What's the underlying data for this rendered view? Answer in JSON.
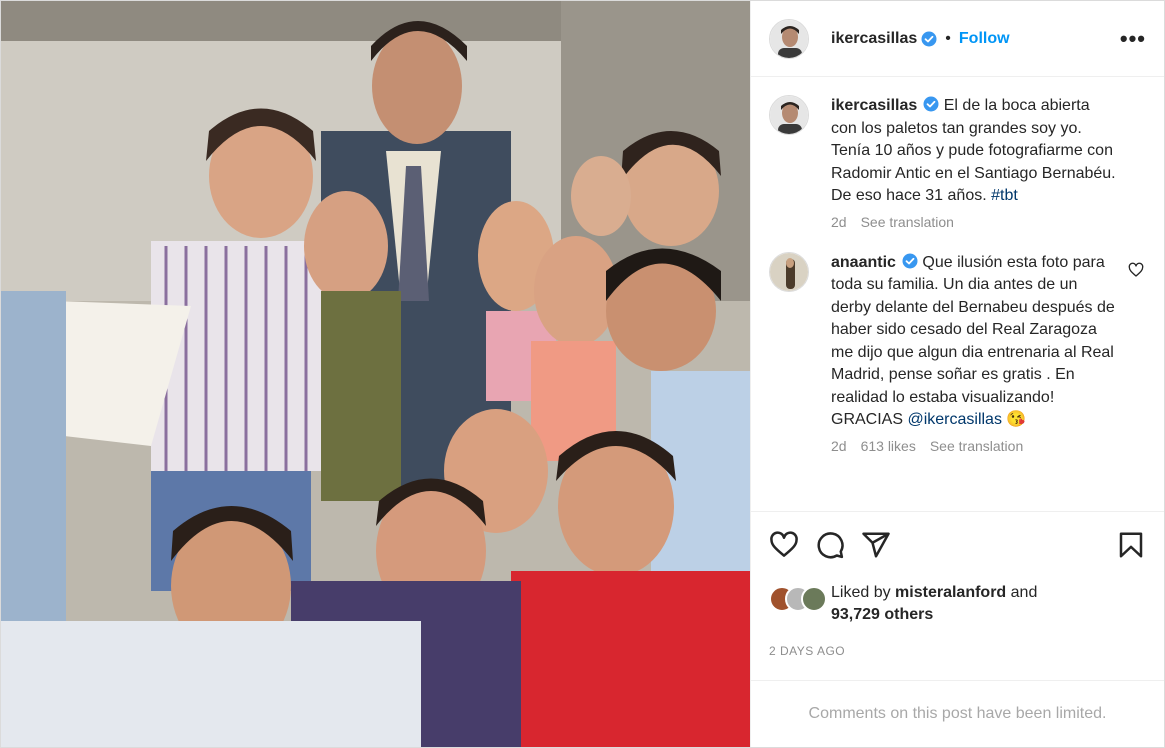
{
  "post": {
    "image_alt": "Group of boys posing with a man in a suit",
    "author": {
      "username": "ikercasillas",
      "verified": true
    },
    "follow_label": "Follow",
    "separator": "•",
    "more_label": "•••"
  },
  "comments": [
    {
      "username": "ikercasillas",
      "text": "El de la boca abierta con los paletos tan grandes soy yo. Tenía 10 años y pude fotografiarme con Radomir Antic en el Santiago Bernabéu. De eso hace 31 años.",
      "hashtag": "#tbt",
      "time": "2d",
      "translate_label": "See translation"
    },
    {
      "username": "anaantic",
      "text": "Que ilusión esta foto para toda su familia. Un dia antes de un derby delante del Bernabeu después de haber sido cesado del Real Zaragoza me dijo que algun dia entrenaria al Real Madrid, pense soñar es gratis . En realidad lo estaba visualizando! GRACIAS",
      "mention": "@ikercasillas",
      "emoji": "😘",
      "time": "2d",
      "likes": "613 likes",
      "translate_label": "See translation"
    }
  ],
  "actions": {
    "like_icon": "heart-icon",
    "comment_icon": "comment-icon",
    "share_icon": "paper-plane-icon",
    "save_icon": "bookmark-icon"
  },
  "likes": {
    "prefix": "Liked by",
    "user": "misteralanford",
    "and": "and",
    "others": "93,729 others"
  },
  "date": "2 DAYS AGO",
  "comments_limited": "Comments on this post have been limited.",
  "colors": {
    "accent": "#0095f6",
    "verified": "#3897f0",
    "text": "#262626",
    "muted": "#8e8e8e"
  }
}
